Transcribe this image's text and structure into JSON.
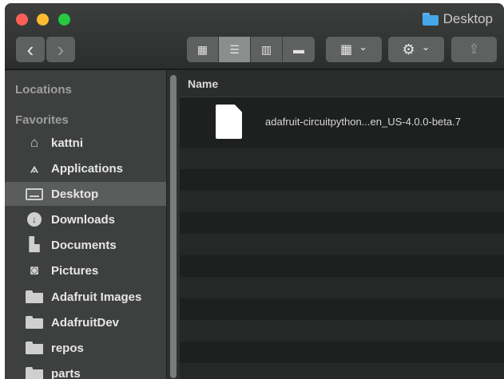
{
  "window": {
    "title": "Desktop"
  },
  "toolbar": {
    "back_glyph": "‹",
    "forward_glyph": "›",
    "view_modes": [
      {
        "name": "icon-view",
        "glyph": "▦"
      },
      {
        "name": "list-view",
        "glyph": "☰"
      },
      {
        "name": "column-view",
        "glyph": "▥"
      },
      {
        "name": "gallery-view",
        "glyph": "▬"
      }
    ],
    "arrange_glyph": "▦",
    "action_glyph": "⚙",
    "dropdown_glyph": "⌄",
    "share_glyph": "⇪"
  },
  "sidebar": {
    "locations_label": "Locations",
    "favorites_label": "Favorites",
    "items": [
      {
        "label": "kattni",
        "icon": "home-icon"
      },
      {
        "label": "Applications",
        "icon": "applications-icon"
      },
      {
        "label": "Desktop",
        "icon": "desktop-icon",
        "selected": true
      },
      {
        "label": "Downloads",
        "icon": "downloads-icon"
      },
      {
        "label": "Documents",
        "icon": "documents-icon"
      },
      {
        "label": "Pictures",
        "icon": "pictures-icon"
      },
      {
        "label": "Adafruit Images",
        "icon": "folder-icon"
      },
      {
        "label": "AdafruitDev",
        "icon": "folder-icon"
      },
      {
        "label": "repos",
        "icon": "folder-icon"
      },
      {
        "label": "parts",
        "icon": "folder-icon"
      }
    ]
  },
  "content": {
    "column_header": "Name",
    "files": [
      {
        "name": "adafruit-circuitpython...en_US-4.0.0-beta.7"
      }
    ]
  },
  "colors": {
    "close": "#fc5f57",
    "minimize": "#fdbc2e",
    "maximize": "#28c840",
    "folder_accent": "#48a7ea"
  }
}
